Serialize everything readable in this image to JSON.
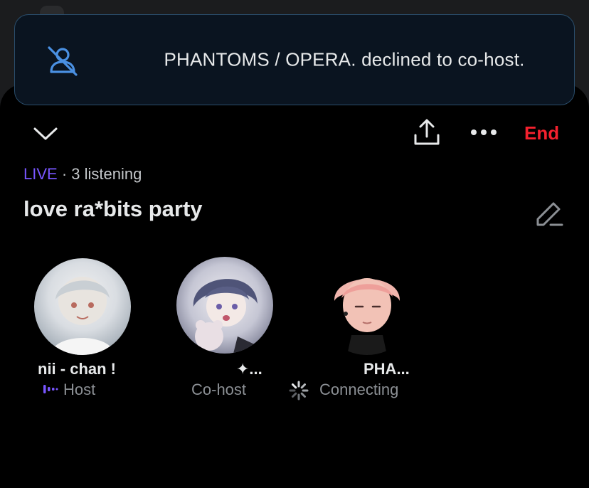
{
  "toast": {
    "message": "PHANTOMS / OPERA. declined to co-host.",
    "icon": "person-declined-icon"
  },
  "header": {
    "collapse_icon": "chevron-down-icon",
    "share_icon": "share-icon",
    "more_icon": "more-dots-icon",
    "end_label": "End"
  },
  "space": {
    "live_label": "LIVE",
    "separator": " · ",
    "listening": "3 listening",
    "title": "love ra*bits party",
    "edit_icon": "edit-pencil-icon"
  },
  "participants": [
    {
      "name": "nii - chan !",
      "role": "Host",
      "role_icon": "speaking-bars-icon"
    },
    {
      "name": "✦...",
      "role": "Co-host"
    },
    {
      "name": "PHA...",
      "role": "Connecting",
      "role_icon": "loading-spinner-icon"
    }
  ],
  "colors": {
    "accent_purple": "#7856ff",
    "end_red": "#f4212e",
    "toast_border": "#2a4d6b",
    "icon_blue": "#4a90e2"
  }
}
